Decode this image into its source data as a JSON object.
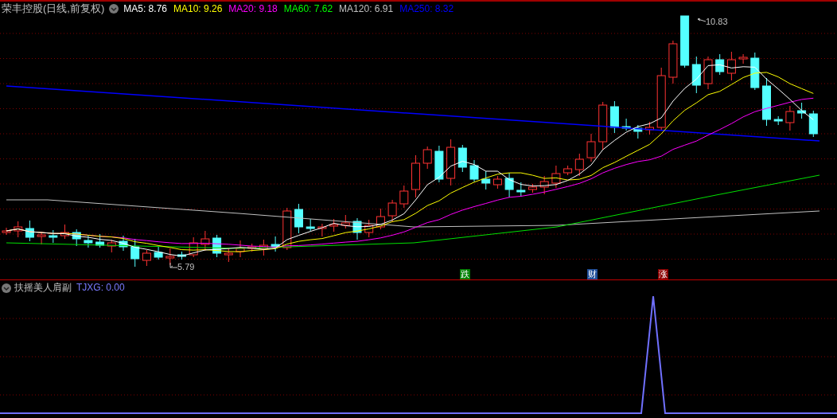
{
  "main_panel": {
    "title": "荣丰控股(日线,前复权)",
    "legend": [
      {
        "label": "MA5: 8.76",
        "color": "#ffffff"
      },
      {
        "label": "MA10: 9.26",
        "color": "#ffff00"
      },
      {
        "label": "MA20: 9.18",
        "color": "#ff00ff"
      },
      {
        "label": "MA60: 7.62",
        "color": "#00ff00"
      },
      {
        "label": "MA120: 6.91",
        "color": "#c0c0c0"
      },
      {
        "label": "MA250: 8.32",
        "color": "#0000ff"
      }
    ],
    "high_label": "10.83",
    "low_label": "5.79",
    "signals": [
      {
        "label": "跌",
        "color": "#008000"
      },
      {
        "label": "财",
        "color": "#1f4e9a"
      },
      {
        "label": "涨",
        "color": "#8b0000"
      }
    ]
  },
  "indicator_panel": {
    "title": "扶摇美人肩副",
    "reading": "TJXG: 0.00"
  }
}
